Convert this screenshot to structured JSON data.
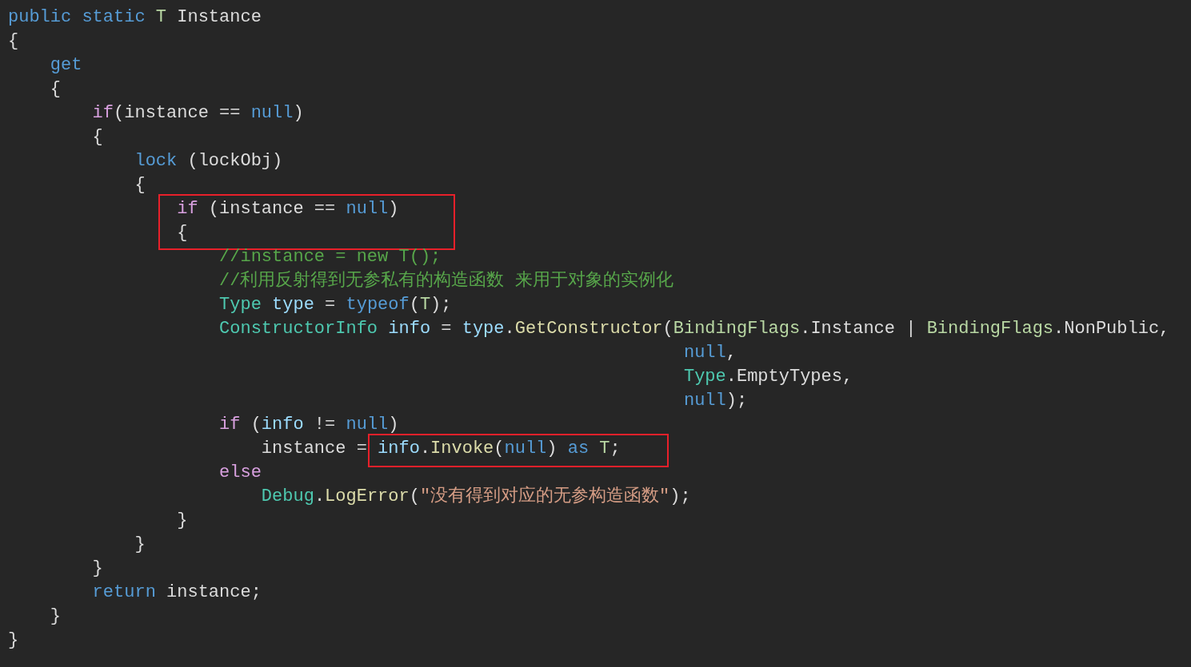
{
  "editor": {
    "lines": [
      {
        "tokens": [
          {
            "kind": "keyword",
            "text": "public static"
          },
          {
            "kind": "typeparam",
            "text": " T"
          },
          {
            "kind": "plain",
            "text": " Instance"
          }
        ]
      },
      {
        "tokens": [
          {
            "kind": "plain",
            "text": "{"
          }
        ]
      },
      {
        "tokens": [
          {
            "kind": "keyword",
            "text": "    get"
          }
        ]
      },
      {
        "tokens": [
          {
            "kind": "plain",
            "text": "    {"
          }
        ]
      },
      {
        "tokens": [
          {
            "kind": "control",
            "text": "        if"
          },
          {
            "kind": "plain",
            "text": "(instance == "
          },
          {
            "kind": "keyword",
            "text": "null"
          },
          {
            "kind": "plain",
            "text": ")"
          }
        ]
      },
      {
        "tokens": [
          {
            "kind": "plain",
            "text": "        {"
          }
        ]
      },
      {
        "tokens": [
          {
            "kind": "keyword",
            "text": "            lock"
          },
          {
            "kind": "plain",
            "text": " (lockObj)"
          }
        ]
      },
      {
        "tokens": [
          {
            "kind": "plain",
            "text": "            {"
          }
        ]
      },
      {
        "highlight": true,
        "tokens": [
          {
            "kind": "control",
            "text": "                if"
          },
          {
            "kind": "plain",
            "text": " (instance == "
          },
          {
            "kind": "keyword",
            "text": "null"
          },
          {
            "kind": "plain",
            "text": ")"
          }
        ]
      },
      {
        "highlight": true,
        "tokens": [
          {
            "kind": "plain",
            "text": "                {"
          }
        ]
      },
      {
        "tokens": [
          {
            "kind": "comment",
            "text": "                    //instance = new T();"
          }
        ]
      },
      {
        "tokens": [
          {
            "kind": "comment",
            "text": "                    //利用反射得到无参私有的构造函数 来用于对象的实例化"
          }
        ]
      },
      {
        "tokens": [
          {
            "kind": "type",
            "text": "                    Type"
          },
          {
            "kind": "variable",
            "text": " type"
          },
          {
            "kind": "plain",
            "text": " = "
          },
          {
            "kind": "keyword",
            "text": "typeof"
          },
          {
            "kind": "plain",
            "text": "("
          },
          {
            "kind": "typeparam",
            "text": "T"
          },
          {
            "kind": "plain",
            "text": ");"
          }
        ]
      },
      {
        "tokens": [
          {
            "kind": "type",
            "text": "                    ConstructorInfo"
          },
          {
            "kind": "variable",
            "text": " info"
          },
          {
            "kind": "plain",
            "text": " = "
          },
          {
            "kind": "variable",
            "text": "type"
          },
          {
            "kind": "plain",
            "text": "."
          },
          {
            "kind": "method",
            "text": "GetConstructor"
          },
          {
            "kind": "plain",
            "text": "("
          },
          {
            "kind": "enum",
            "text": "BindingFlags"
          },
          {
            "kind": "plain",
            "text": ".Instance | "
          },
          {
            "kind": "enum",
            "text": "BindingFlags"
          },
          {
            "kind": "plain",
            "text": ".NonPublic,"
          }
        ]
      },
      {
        "tokens": [
          {
            "kind": "keyword",
            "text": "                                                                null"
          },
          {
            "kind": "plain",
            "text": ","
          }
        ]
      },
      {
        "tokens": [
          {
            "kind": "type",
            "text": "                                                                Type"
          },
          {
            "kind": "plain",
            "text": ".EmptyTypes,"
          }
        ]
      },
      {
        "tokens": [
          {
            "kind": "keyword",
            "text": "                                                                null"
          },
          {
            "kind": "plain",
            "text": ");"
          }
        ]
      },
      {
        "tokens": [
          {
            "kind": "control",
            "text": "                    if"
          },
          {
            "kind": "plain",
            "text": " ("
          },
          {
            "kind": "variable",
            "text": "info"
          },
          {
            "kind": "plain",
            "text": " != "
          },
          {
            "kind": "keyword",
            "text": "null"
          },
          {
            "kind": "plain",
            "text": ")"
          }
        ]
      },
      {
        "tokens": [
          {
            "kind": "plain",
            "text": "                        instance = "
          }
        ],
        "boxed_tokens": [
          {
            "kind": "variable",
            "text": "info"
          },
          {
            "kind": "plain",
            "text": "."
          },
          {
            "kind": "method",
            "text": "Invoke"
          },
          {
            "kind": "plain",
            "text": "("
          },
          {
            "kind": "keyword",
            "text": "null"
          },
          {
            "kind": "plain",
            "text": ") "
          },
          {
            "kind": "keyword",
            "text": "as"
          },
          {
            "kind": "typeparam",
            "text": " T"
          },
          {
            "kind": "plain",
            "text": ";"
          }
        ]
      },
      {
        "tokens": [
          {
            "kind": "control",
            "text": "                    else"
          }
        ]
      },
      {
        "tokens": [
          {
            "kind": "type",
            "text": "                        Debug"
          },
          {
            "kind": "plain",
            "text": "."
          },
          {
            "kind": "method",
            "text": "LogError"
          },
          {
            "kind": "plain",
            "text": "("
          },
          {
            "kind": "string",
            "text": "\"没有得到对应的无参构造函数\""
          },
          {
            "kind": "plain",
            "text": ");"
          }
        ]
      },
      {
        "tokens": [
          {
            "kind": "plain",
            "text": "                }"
          }
        ]
      },
      {
        "tokens": [
          {
            "kind": "plain",
            "text": "            }"
          }
        ]
      },
      {
        "tokens": [
          {
            "kind": "plain",
            "text": "        }"
          }
        ]
      },
      {
        "tokens": [
          {
            "kind": "keyword",
            "text": "        return"
          },
          {
            "kind": "plain",
            "text": " instance;"
          }
        ]
      },
      {
        "tokens": [
          {
            "kind": "plain",
            "text": "    }"
          }
        ]
      },
      {
        "tokens": [
          {
            "kind": "plain",
            "text": "}"
          }
        ]
      }
    ]
  }
}
